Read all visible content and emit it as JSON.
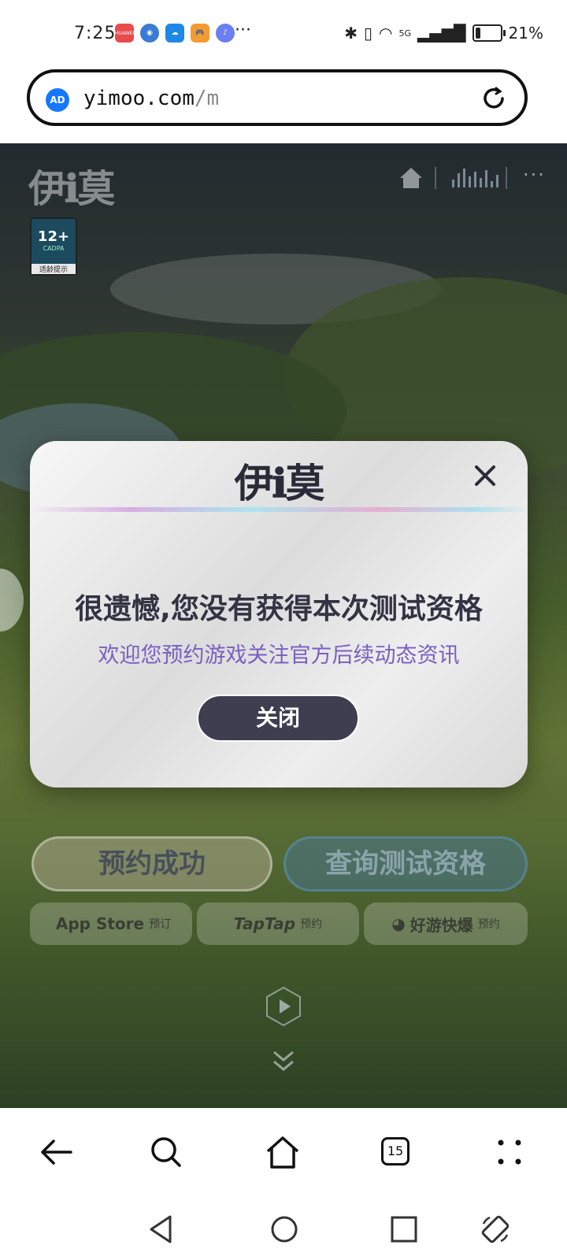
{
  "status_bar": {
    "time": "7:25",
    "notification_icons": [
      {
        "name": "huawei-store-icon",
        "color": "#e84b4b",
        "label": "HUAWEI"
      },
      {
        "name": "browser-icon",
        "color": "#3a7bd5",
        "label": ""
      },
      {
        "name": "weather-icon",
        "color": "#1e88e5",
        "label": ""
      },
      {
        "name": "game-center-icon",
        "color": "#f39c33",
        "label": ""
      },
      {
        "name": "music-icon",
        "color": "#6a7ff0",
        "label": ""
      }
    ],
    "more_notifications": "···",
    "network": "5G",
    "battery_percent": "21%",
    "battery_level": 0.21
  },
  "url_bar": {
    "ad_badge": "AD",
    "domain": "yimoo.com",
    "path": "/m"
  },
  "webpage": {
    "logo": "伊ℹ莫",
    "age_rating": "12+",
    "age_org": "CADPA",
    "age_tip": "适龄提示",
    "primary_buttons": {
      "reserved": "预约成功",
      "query": "查询测试资格"
    },
    "stores": [
      {
        "name": "App Store",
        "action": "预订"
      },
      {
        "name": "TapTap",
        "action": "预约"
      },
      {
        "name": "好游快爆",
        "action": "预约"
      }
    ]
  },
  "modal": {
    "logo": "伊ℹ莫",
    "title": "很遗憾,您没有获得本次测试资格",
    "subtitle": "欢迎您预约游戏关注官方后续动态资讯",
    "close_button": "关闭"
  },
  "browser_toolbar": {
    "tab_count": "15"
  }
}
